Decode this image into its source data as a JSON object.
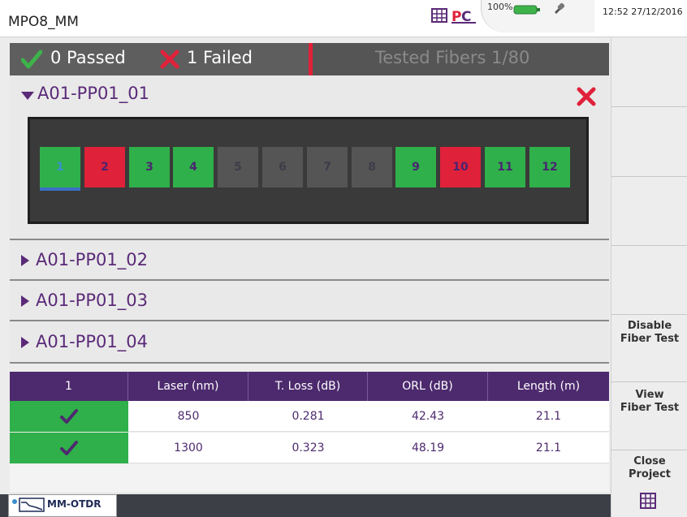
{
  "header": {
    "title": "MPO8_MM",
    "battery": "100%",
    "time": "12:52 27/12/2016"
  },
  "summary": {
    "passed": "0 Passed",
    "failed": "1 Failed",
    "tested": "Tested Fibers 1/80"
  },
  "sections": [
    {
      "label": "A01-PP01_01",
      "expanded": true,
      "status": "failed"
    },
    {
      "label": "A01-PP01_02",
      "expanded": false
    },
    {
      "label": "A01-PP01_03",
      "expanded": false
    },
    {
      "label": "A01-PP01_04",
      "expanded": false
    }
  ],
  "fibers": [
    {
      "n": "1",
      "state": "pass",
      "selected": true
    },
    {
      "n": "2",
      "state": "fail"
    },
    {
      "n": "3",
      "state": "pass"
    },
    {
      "n": "4",
      "state": "pass"
    },
    {
      "n": "5",
      "state": "untested"
    },
    {
      "n": "6",
      "state": "untested"
    },
    {
      "n": "7",
      "state": "untested"
    },
    {
      "n": "8",
      "state": "untested"
    },
    {
      "n": "9",
      "state": "pass"
    },
    {
      "n": "10",
      "state": "fail"
    },
    {
      "n": "11",
      "state": "pass"
    },
    {
      "n": "12",
      "state": "pass"
    }
  ],
  "table": {
    "headers": [
      "1",
      "Laser (nm)",
      "T. Loss (dB)",
      "ORL (dB)",
      "Length (m)"
    ],
    "rows": [
      {
        "status": "pass",
        "laser": "850",
        "loss": "0.281",
        "orl": "42.43",
        "length": "21.1"
      },
      {
        "status": "pass",
        "laser": "1300",
        "loss": "0.323",
        "orl": "48.19",
        "length": "21.1"
      }
    ]
  },
  "mode": {
    "label": "MM-OTDR"
  },
  "softkeys": {
    "disable_fiber_test": "Disable\nFiber Test",
    "view_fiber_test": "View\nFiber Test",
    "close_project": "Close\nProject"
  },
  "colors": {
    "pass": "#2fb04a",
    "fail": "#e0213a",
    "accent": "#4d2a6e",
    "untested": "#555555"
  }
}
